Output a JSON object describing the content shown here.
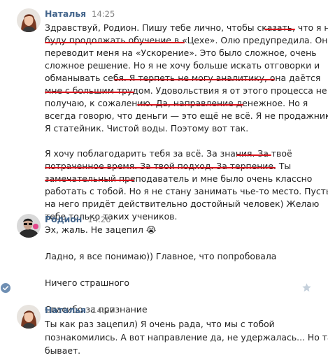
{
  "conversation": {
    "messages": [
      {
        "author": "Наталья",
        "time": "14:25",
        "avatar": "female-avatar",
        "lines": [
          "Здравствуй, Родион. Пишу тебе лично, чтобы сказать, что я не",
          "буду продолжать обучение в «Цехе». Олю предупредила. Она",
          "переводит меня на «Ускорение». Это было сложное, очень",
          "сложное решение. Но я не хочу больше искать отговорки и",
          "обманывать себя. Я терпеть не могу аналитику, она даётся",
          "мне с большим трудом. Удовольствия я от этого процесса не",
          "получаю, к сожалению. Да, направление денежное. Но я",
          "всегда говорю, что деньги — это ещё не всё. Я не продажник.",
          "Я статейник. Чистой воды. Поэтому вот так.",
          "",
          "Я хочу поблагодарить тебя за всё. За знания. За твоё",
          "потраченное время. За твой подход. За терпение. Ты",
          "замечательный преподаватель и мне было очень классно",
          "работать с тобой. Но я не стану занимать чье-то место. Пусть",
          "на него придёт действительно достойный человек) Желаю",
          "тебе только таких учеников."
        ]
      },
      {
        "author": "Родион",
        "time": "14:26",
        "avatar": "male-avatar",
        "lines": [
          "Эх, жаль. Не зацепил 😭",
          "",
          "Ладно, я все понимаю)) Главное, что попробовала",
          "",
          "Ничего страшного",
          "",
          "Спасибо за признание"
        ]
      },
      {
        "author": "Наталья",
        "time": "14:27",
        "avatar": "female-avatar",
        "lines": [
          "Ты как раз зацепил) Я очень рада, что мы с тобой",
          "познакомились. А вот направление да, не удержалась... Но так",
          "бывает."
        ]
      }
    ],
    "icons": {
      "read_check": "check-circle-icon",
      "favorite": "star-icon"
    },
    "colors": {
      "author": "#42648b",
      "time": "#828282",
      "text": "#222222",
      "underline": "#d8121b",
      "icon": "#c5d0db"
    }
  }
}
